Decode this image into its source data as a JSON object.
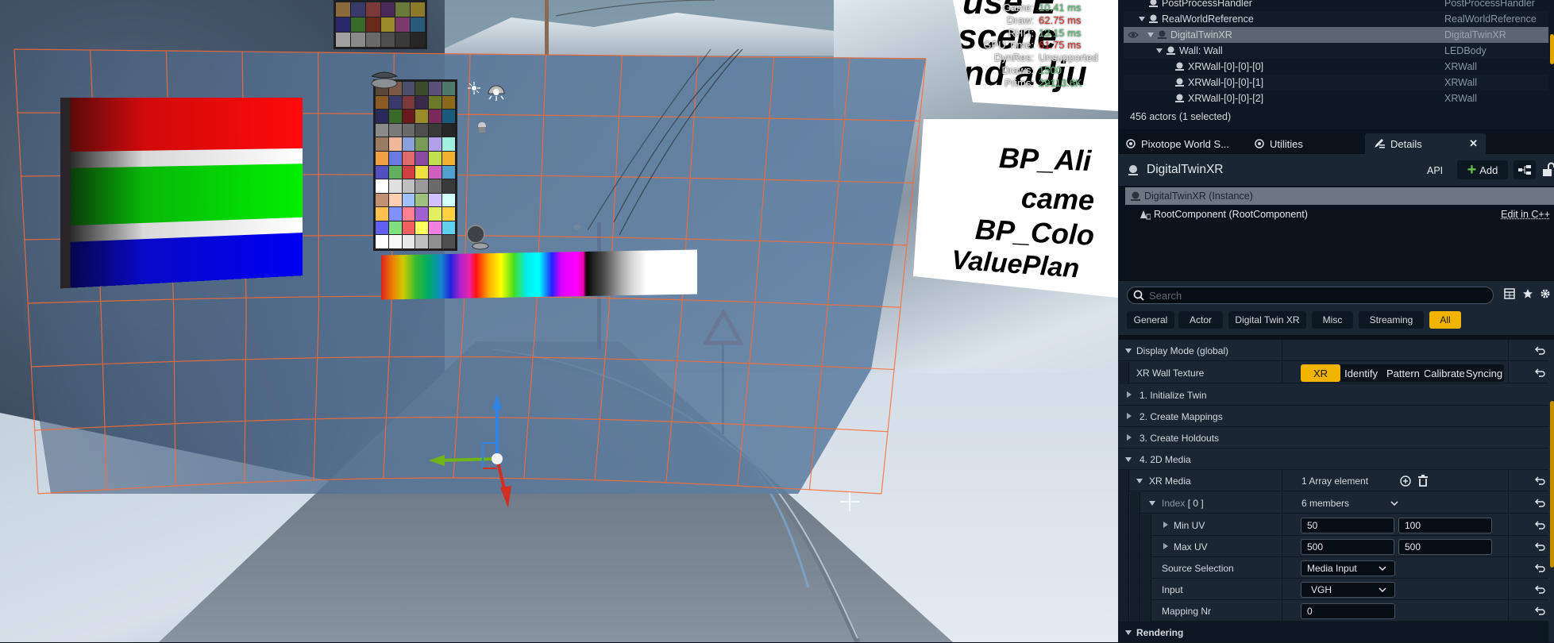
{
  "viewport": {
    "stats": [
      {
        "label": "Game:",
        "value": "10.41 ms",
        "color": "green"
      },
      {
        "label": "Draw:",
        "value": "62.75 ms",
        "color": "red"
      },
      {
        "label": "RHIT:",
        "value": "13.15 ms",
        "color": "green"
      },
      {
        "label": "GPU Time:",
        "value": "61.75 ms",
        "color": "red"
      },
      {
        "label": "DynRes:",
        "value": "Unsupported",
        "color": "white"
      },
      {
        "label": "Draws:",
        "value": "1500",
        "color": "green"
      },
      {
        "label": "Prims:",
        "value": "29113.6K",
        "color": "green"
      }
    ],
    "sign_lines": [
      "use E",
      "scene",
      "and adju",
      "BP_Ali",
      "came",
      "BP_Colo",
      "ValuePlan"
    ],
    "colors": {
      "grid_line": "#ff6a30",
      "led_wall": "#5a7898"
    }
  },
  "outliner": {
    "rows": [
      {
        "name": "PostProcessHandler",
        "type": "PostProcessHandler",
        "depth": 1,
        "expanded": null
      },
      {
        "name": "RealWorldReference",
        "type": "RealWorldReference",
        "depth": 1,
        "expanded": true
      },
      {
        "name": "DigitalTwinXR",
        "type": "DigitalTwinXR",
        "depth": 2,
        "expanded": true,
        "selected": true
      },
      {
        "name": "Wall: Wall",
        "type": "LEDBody",
        "depth": 3,
        "expanded": true
      },
      {
        "name": "XRWall-[0]-[0]-[0]",
        "type": "XRWall",
        "depth": 4,
        "expanded": null
      },
      {
        "name": "XRWall-[0]-[0]-[1]",
        "type": "XRWall",
        "depth": 4,
        "expanded": null
      },
      {
        "name": "XRWall-[0]-[0]-[2]",
        "type": "XRWall",
        "depth": 4,
        "expanded": null
      }
    ],
    "actor_count": "456 actors (1 selected)"
  },
  "tabs": [
    {
      "label": "Pixotope World S...",
      "icon": "world-settings-icon",
      "active": false
    },
    {
      "label": "Utilities",
      "icon": "utilities-icon",
      "active": false
    },
    {
      "label": "Details",
      "icon": "details-pencil-icon",
      "active": true
    }
  ],
  "details": {
    "actor_name": "DigitalTwinXR",
    "api_label": "API",
    "add_label": "Add",
    "instance_label": "DigitalTwinXR (Instance)",
    "root_component_label": "RootComponent (RootComponent)",
    "edit_cpp_label": "Edit in C++",
    "search_placeholder": "Search",
    "filters": [
      {
        "label": "General",
        "active": false
      },
      {
        "label": "Actor",
        "active": false
      },
      {
        "label": "Digital Twin XR",
        "active": false
      },
      {
        "label": "Misc",
        "active": false
      },
      {
        "label": "Streaming",
        "active": false
      },
      {
        "label": "All",
        "active": true
      }
    ],
    "accent_color": "#f0b400",
    "properties": {
      "display_mode": "Display Mode (global)",
      "xr_wall_texture": "XR Wall Texture",
      "texture_modes": [
        {
          "label": "XR",
          "active": true
        },
        {
          "label": "Identify",
          "active": false
        },
        {
          "label": "Pattern",
          "active": false
        },
        {
          "label": "Calibrate",
          "active": false
        },
        {
          "label": "Syncing",
          "active": false
        }
      ],
      "cat1": "1. Initialize Twin",
      "cat2": "2. Create Mappings",
      "cat3": "3. Create Holdouts",
      "cat4": "4. 2D Media",
      "xr_media": "XR Media",
      "xr_media_value": "1 Array element",
      "index_label": "Index",
      "index_value": "[ 0 ]",
      "index_members": "6 members",
      "min_uv": "Min UV",
      "min_uv_x": "50",
      "min_uv_y": "100",
      "max_uv": "Max UV",
      "max_uv_x": "500",
      "max_uv_y": "500",
      "source_selection": "Source Selection",
      "source_selection_value": "Media Input",
      "input": "Input",
      "input_value": "VGH",
      "mapping_nr": "Mapping Nr",
      "mapping_nr_value": "0",
      "rendering": "Rendering"
    }
  }
}
